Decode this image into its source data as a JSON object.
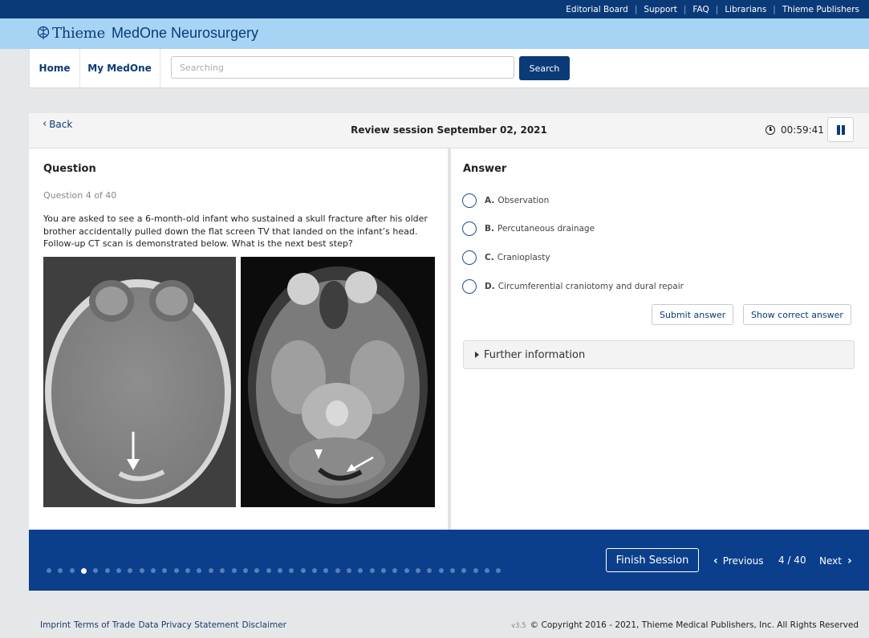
{
  "top_links": [
    "Editorial Board",
    "Support",
    "FAQ",
    "Librarians",
    "Thieme Publishers"
  ],
  "brand": {
    "publisher": "Thieme",
    "product": "MedOne Neurosurgery"
  },
  "nav": {
    "home": "Home",
    "my_medone": "My MedOne"
  },
  "search": {
    "placeholder": "Searching",
    "button": "Search"
  },
  "session": {
    "back": "Back",
    "title": "Review session September 02, 2021",
    "timer": "00:59:41"
  },
  "question": {
    "heading": "Question",
    "counter": "Question 4 of 40",
    "text": "You are asked to see a 6-month-old infant who sustained a skull fracture after his older brother accidentally pulled down the flat screen TV that landed on the infant’s head. Follow-up CT scan is demonstrated below. What is the next best step?"
  },
  "answer": {
    "heading": "Answer",
    "options": [
      {
        "letter": "A.",
        "text": "Observation"
      },
      {
        "letter": "B.",
        "text": "Percutaneous drainage"
      },
      {
        "letter": "C.",
        "text": "Cranioplasty"
      },
      {
        "letter": "D.",
        "text": "Circumferential craniotomy and dural repair"
      }
    ],
    "submit": "Submit answer",
    "show_correct": "Show correct answer",
    "further_info": "Further information"
  },
  "pagination": {
    "finish": "Finish Session",
    "previous": "Previous",
    "position": "4 / 40",
    "next": "Next",
    "total_questions": 40,
    "current_index": 4
  },
  "footer": {
    "links": [
      "Imprint",
      "Terms of Trade",
      "Data Privacy Statement",
      "Disclaimer"
    ],
    "version": "v3.5",
    "copyright": "© Copyright 2016 - 2021, Thieme Medical Publishers, Inc. All Rights Reserved"
  },
  "colors": {
    "navy": "#0b3a78",
    "brand_bar": "#a7d3f4",
    "bottom_bar": "#0b3f8c"
  }
}
